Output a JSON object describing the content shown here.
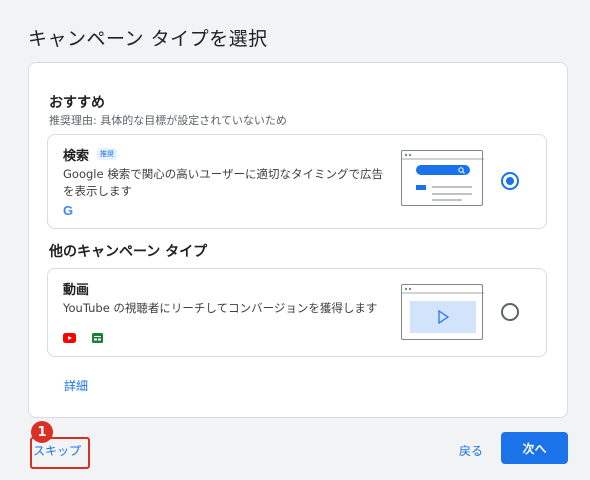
{
  "dialog": {
    "title": "キャンペーン タイプを選択"
  },
  "recommended": {
    "heading": "おすすめ",
    "reason": "推奨理由: 具体的な目標が設定されていないため",
    "card": {
      "title": "検索",
      "badge": "推奨",
      "description": "Google 検索で関心の高いユーザーに適切なタイミングで広告を表示します",
      "icons": [
        "google-g-icon"
      ],
      "selected": true
    }
  },
  "other": {
    "heading": "他のキャンペーン タイプ",
    "card": {
      "title": "動画",
      "description": "YouTube の視聴者にリーチしてコンバージョンを獲得します",
      "icons": [
        "youtube-icon",
        "display-icon"
      ],
      "selected": false
    }
  },
  "details_link": "詳細",
  "footer": {
    "skip_label": "スキップ",
    "back_label": "戻る",
    "next_label": "次へ"
  },
  "annotation": {
    "number": "1"
  },
  "colors": {
    "accent": "#1a73e8",
    "annotation": "#d93025",
    "youtube": "#ff0000",
    "display": "#188038"
  }
}
